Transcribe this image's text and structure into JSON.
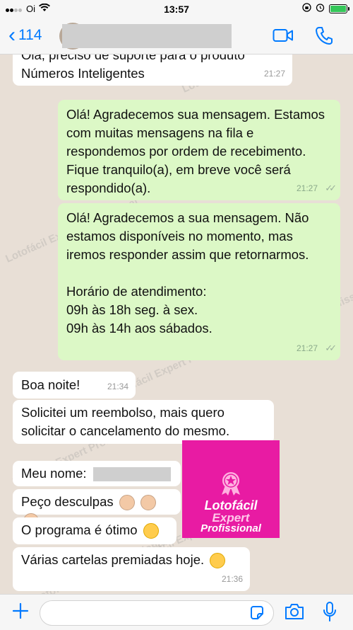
{
  "status_bar": {
    "carrier": "Oi",
    "time": "13:57"
  },
  "header": {
    "back_count": "114"
  },
  "watermark": "Lotofácil Expert Profissional",
  "messages": {
    "m0_line1": "Olá, preciso de suporte para o produto",
    "m0_line2": "Números Inteligentes",
    "m0_time": "21:27",
    "m1_text": "Olá! Agradecemos sua mensagem. Estamos com muitas mensagens na fila e respondemos por ordem de recebimento. Fique tranquilo(a), em breve você será respondido(a).",
    "m1_time": "21:27",
    "m2_p1": "Olá! Agradecemos a sua mensagem. Não estamos disponíveis no momento, mas iremos responder assim que retornarmos.",
    "m2_p2": "Horário de atendimento:",
    "m2_p3": "09h às 18h seg. à sex.",
    "m2_p4": "09h às 14h aos sábados.",
    "m2_time": "21:27",
    "m3_text": "Boa noite!",
    "m3_time": "21:34",
    "m4_text": "Solicitei um reembolso, mais quero solicitar o cancelamento do mesmo.",
    "m5_text": "Meu nome:",
    "m6_text": "Peço desculpas",
    "m7_text": "O programa é ótimo",
    "m8_text": "Várias cartelas premiadas hoje.",
    "m8_time": "21:36"
  },
  "logo": {
    "line1": "Lotofácil",
    "line2": "Expert",
    "line3": "Profissional",
    "color": "#e81ba3"
  },
  "colors": {
    "accent": "#007aff",
    "outgoing_bubble": "#dcf8c6",
    "incoming_bubble": "#ffffff"
  }
}
